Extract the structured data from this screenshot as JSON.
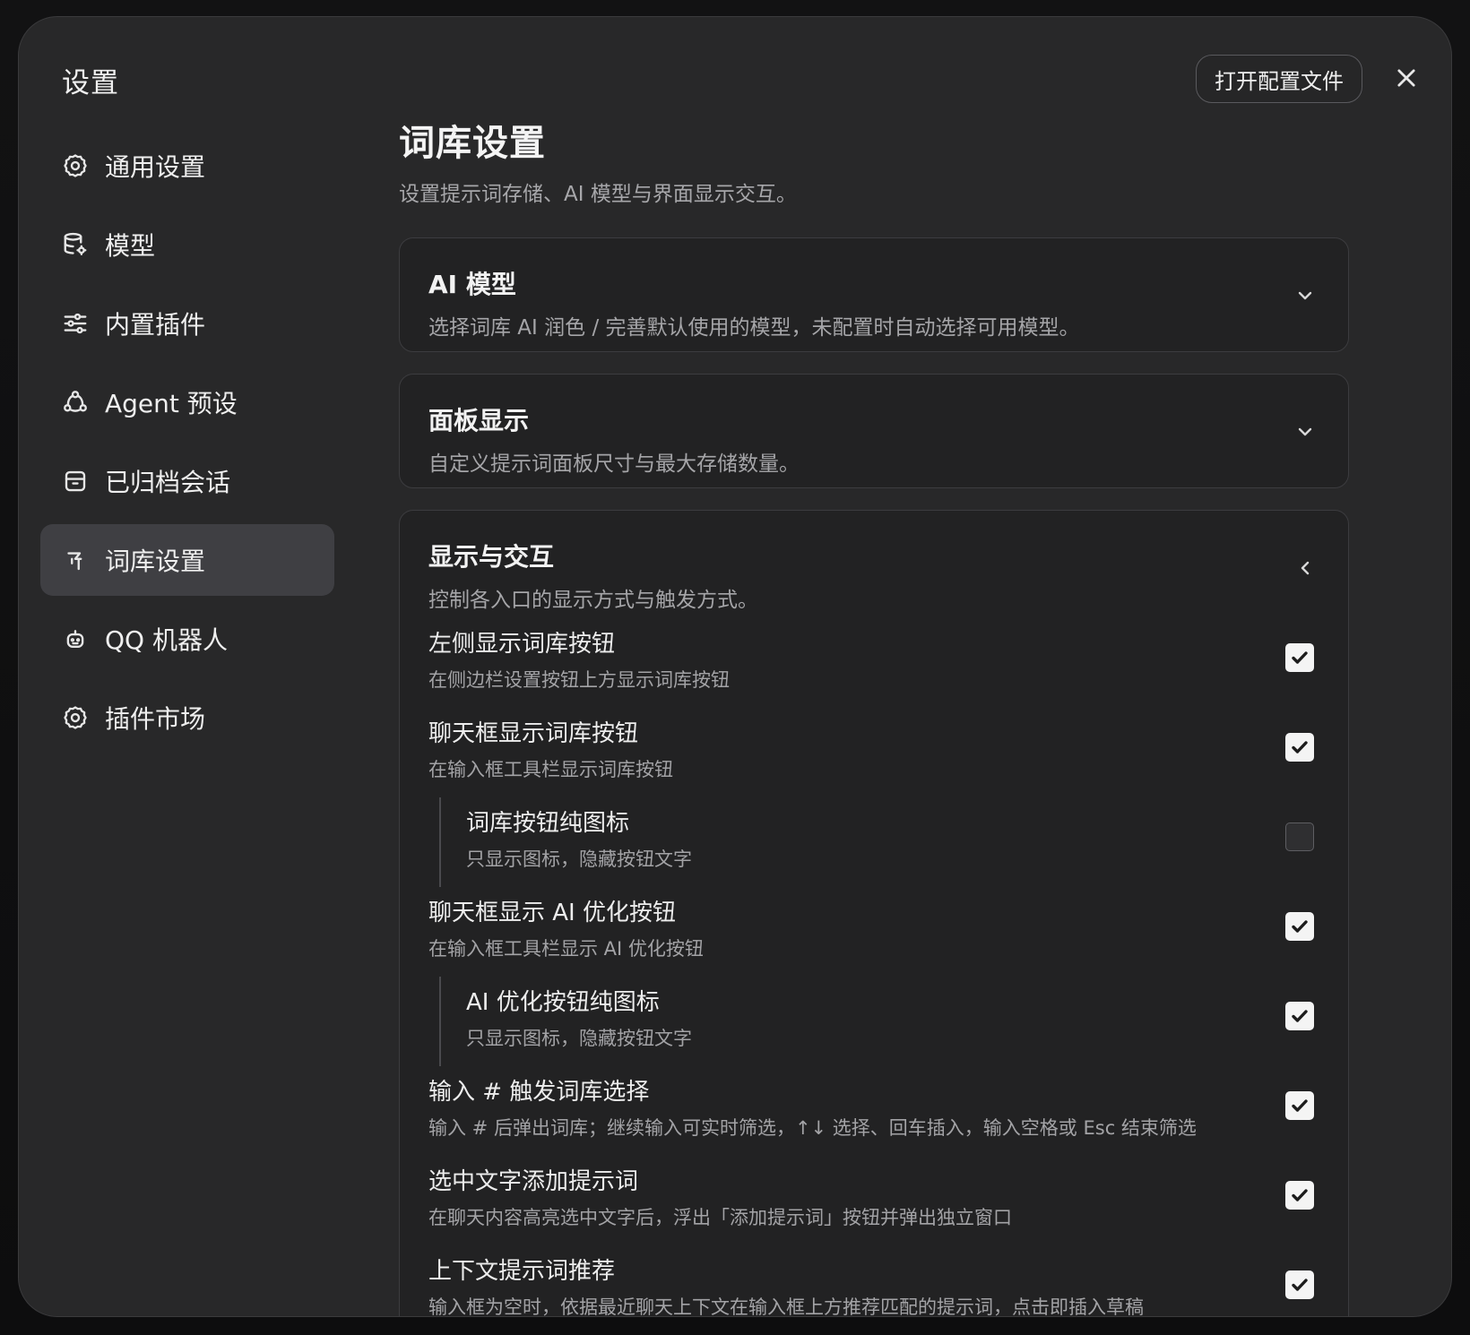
{
  "dialog": {
    "title": "设置",
    "open_config_label": "打开配置文件"
  },
  "sidebar": {
    "items": [
      {
        "label": "通用设置",
        "icon": "gear-icon"
      },
      {
        "label": "模型",
        "icon": "database-gear-icon"
      },
      {
        "label": "内置插件",
        "icon": "sliders-icon"
      },
      {
        "label": "Agent 预设",
        "icon": "agent-nodes-icon"
      },
      {
        "label": "已归档会话",
        "icon": "archive-icon"
      },
      {
        "label": "词库设置",
        "icon": "lexicon-icon",
        "active": true
      },
      {
        "label": "QQ 机器人",
        "icon": "bot-icon"
      },
      {
        "label": "插件市场",
        "icon": "gear-icon"
      }
    ]
  },
  "main": {
    "title": "词库设置",
    "subtitle": "设置提示词存储、AI 模型与界面显示交互。",
    "sections": [
      {
        "title": "AI 模型",
        "desc": "选择词库 AI 润色 / 完善默认使用的模型，未配置时自动选择可用模型。",
        "expanded": false
      },
      {
        "title": "面板显示",
        "desc": "自定义提示词面板尺寸与最大存储数量。",
        "expanded": false
      },
      {
        "title": "显示与交互",
        "desc": "控制各入口的显示方式与触发方式。",
        "expanded": true
      }
    ],
    "options": [
      {
        "title": "左侧显示词库按钮",
        "desc": "在侧边栏设置按钮上方显示词库按钮",
        "checked": true,
        "sub": false
      },
      {
        "title": "聊天框显示词库按钮",
        "desc": "在输入框工具栏显示词库按钮",
        "checked": true,
        "sub": false
      },
      {
        "title": "词库按钮纯图标",
        "desc": "只显示图标，隐藏按钮文字",
        "checked": false,
        "sub": true
      },
      {
        "title": "聊天框显示 AI 优化按钮",
        "desc": "在输入框工具栏显示 AI 优化按钮",
        "checked": true,
        "sub": false
      },
      {
        "title": "AI 优化按钮纯图标",
        "desc": "只显示图标，隐藏按钮文字",
        "checked": true,
        "sub": true
      },
      {
        "title": "输入 # 触发词库选择",
        "desc": "输入 # 后弹出词库；继续输入可实时筛选，↑↓ 选择、回车插入，输入空格或 Esc 结束筛选",
        "checked": true,
        "sub": false
      },
      {
        "title": "选中文字添加提示词",
        "desc": "在聊天内容高亮选中文字后，浮出「添加提示词」按钮并弹出独立窗口",
        "checked": true,
        "sub": false
      },
      {
        "title": "上下文提示词推荐",
        "desc": "输入框为空时，依据最近聊天上下文在输入框上方推荐匹配的提示词，点击即插入草稿",
        "checked": true,
        "sub": false
      }
    ]
  },
  "colors": {
    "dialog_bg": "#282829",
    "card_bg": "#222223",
    "active_item_bg": "#3f3f43",
    "checkbox_on": "#f4f4f4"
  }
}
